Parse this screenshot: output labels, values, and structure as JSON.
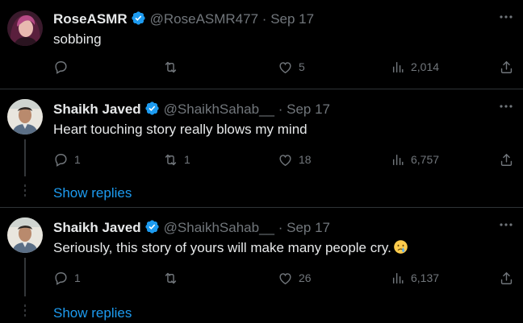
{
  "colors": {
    "background": "#000000",
    "text": "#e7e9ea",
    "muted": "#71767b",
    "link": "#1d9bf0",
    "verified": "#1d9bf0",
    "divider": "#2f3336"
  },
  "tweets": [
    {
      "name": "RoseASMR",
      "handle": "@RoseASMR477",
      "separator": "·",
      "date": "Sep 17",
      "text": "sobbing",
      "replies": "",
      "retweets": "",
      "likes": "5",
      "views": "2,014",
      "avatar_icon": "avatar-rose-icon"
    },
    {
      "name": "Shaikh Javed",
      "handle": "@ShaikhSahab__",
      "separator": "·",
      "date": "Sep 17",
      "text": "Heart touching story really blows my mind",
      "replies": "1",
      "retweets": "1",
      "likes": "18",
      "views": "6,757",
      "show_replies": "Show replies",
      "avatar_icon": "avatar-shaikh-icon"
    },
    {
      "name": "Shaikh Javed",
      "handle": "@ShaikhSahab__",
      "separator": "·",
      "date": "Sep 17",
      "text": "Seriously, this story of yours will make many people cry.",
      "emoji": "crying-face-icon",
      "replies": "1",
      "retweets": "",
      "likes": "26",
      "views": "6,137",
      "show_replies": "Show replies",
      "avatar_icon": "avatar-shaikh-icon"
    }
  ]
}
